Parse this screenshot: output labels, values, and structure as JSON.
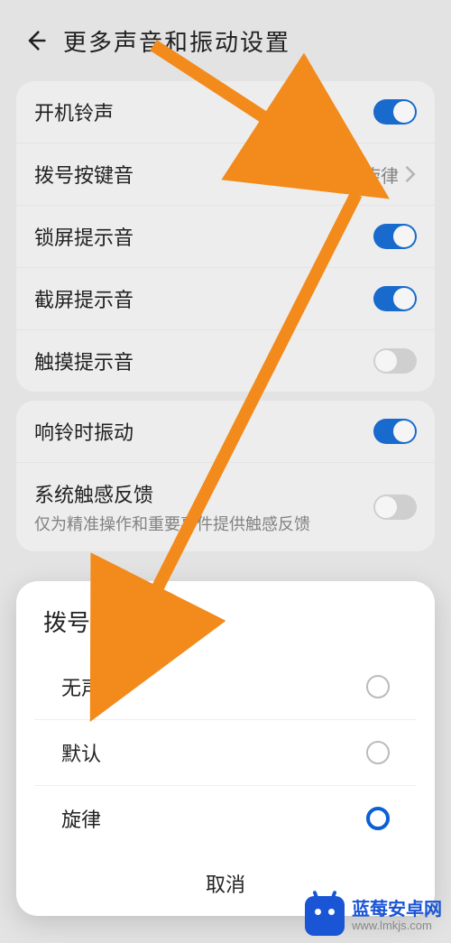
{
  "header": {
    "title": "更多声音和振动设置"
  },
  "card1": {
    "rows": [
      {
        "label": "开机铃声",
        "toggle": true
      },
      {
        "label": "拨号按键音",
        "value": "旋律",
        "toggle": null
      },
      {
        "label": "锁屏提示音",
        "toggle": true
      },
      {
        "label": "截屏提示音",
        "toggle": true
      },
      {
        "label": "触摸提示音",
        "toggle": false
      }
    ]
  },
  "card2": {
    "rows": [
      {
        "label": "响铃时振动",
        "sub": "",
        "toggle": true
      },
      {
        "label": "系统触感反馈",
        "sub": "仅为精准操作和重要事件提供触感反馈",
        "toggle": false
      }
    ]
  },
  "sheet": {
    "title": "拨号按键音",
    "options": [
      {
        "label": "无声",
        "selected": false
      },
      {
        "label": "默认",
        "selected": false
      },
      {
        "label": "旋律",
        "selected": true
      }
    ],
    "cancel": "取消"
  },
  "watermark": {
    "name": "蓝莓安卓网",
    "url": "www.lmkjs.com"
  },
  "colors": {
    "accent": "#1a6fd6",
    "arrow": "#f28a1c"
  }
}
